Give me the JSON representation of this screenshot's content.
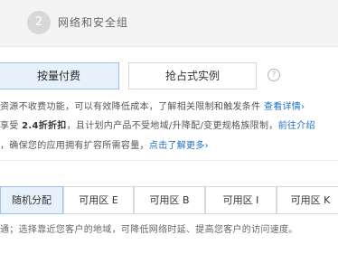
{
  "step": {
    "number": "2",
    "title": "网络和安全组"
  },
  "billing": {
    "payg_label": "按量付费",
    "spot_label": "抢占式实例",
    "help_icon": "?"
  },
  "info": {
    "line1_text": "资源不收费功能，可以有效降低成本，了解相关限制和触发条件",
    "line1_link": "查看详情›",
    "line2_prefix": "享受",
    "line2_bold": "2.4折折扣",
    "line2_text": "，且计划内产品不受地域/升降配/变更规格族限制，",
    "line2_link": "前往介绍",
    "line3_text": "，确保您的应用拥有扩容所需容量，",
    "line3_link": "点击了解更多›"
  },
  "zones": {
    "tabs": [
      "随机分配",
      "可用区 E",
      "可用区 B",
      "可用区 I",
      "可用区 K"
    ],
    "description": "通；选择靠近您客户的地域，可降低网络时延、提高您客户的访问速度。"
  },
  "colors": {
    "accent": "#1e6fc1",
    "active_bg": "#e7f1fb",
    "active_border": "#9ec5ec"
  }
}
